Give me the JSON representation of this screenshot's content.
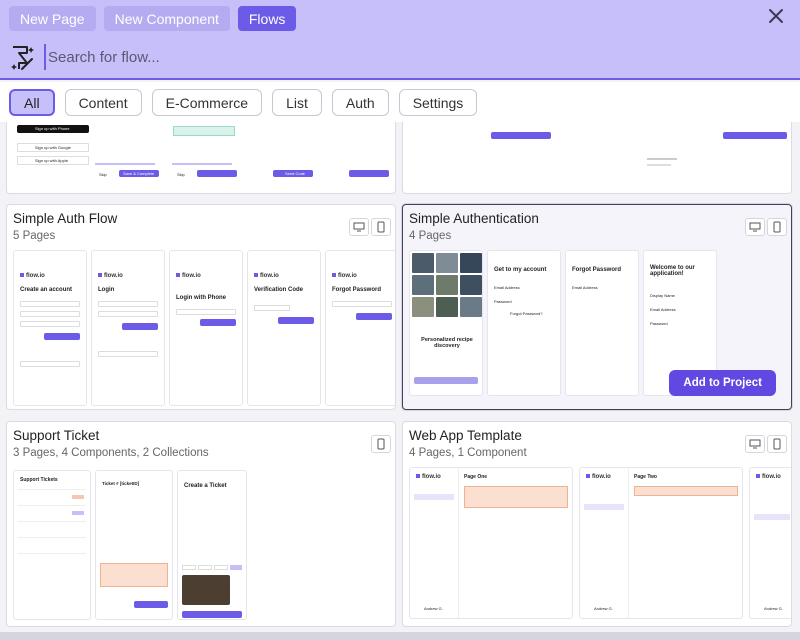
{
  "header": {
    "tabs": [
      {
        "label": "New Page",
        "active": false
      },
      {
        "label": "New Component",
        "active": false
      },
      {
        "label": "Flows",
        "active": true
      }
    ]
  },
  "search": {
    "placeholder": "Search for flow..."
  },
  "filters": [
    {
      "label": "All",
      "active": true
    },
    {
      "label": "Content",
      "active": false
    },
    {
      "label": "E-Commerce",
      "active": false
    },
    {
      "label": "List",
      "active": false
    },
    {
      "label": "Auth",
      "active": false
    },
    {
      "label": "Settings",
      "active": false
    }
  ],
  "colors": {
    "accent": "#6b5be6",
    "header_bg": "#c7bff9",
    "button": "#6048e0"
  },
  "cards": {
    "auth_flow": {
      "title": "Simple Auth Flow",
      "subtitle": "5 Pages"
    },
    "authentication": {
      "title": "Simple Authentication",
      "subtitle": "4 Pages",
      "action": "Add to Project"
    },
    "support": {
      "title": "Support Ticket",
      "subtitle": "3 Pages, 4 Components, 2 Collections"
    },
    "webapp": {
      "title": "Web App Template",
      "subtitle": "4 Pages, 1 Component"
    }
  },
  "previews": {
    "top_left": {
      "signup_btn": "Sign up with Phone",
      "google": "Sign up with Google",
      "apple": "Sign up with Apple",
      "skip": "Skip",
      "save": "Save & Complete",
      "send": "Send Code"
    },
    "auth_flow": {
      "logo": "flow.io",
      "screens": [
        "Create an account",
        "Login",
        "Login with Phone",
        "Verification Code",
        "Forgot Password"
      ],
      "button_labels": [
        "Create Account",
        "Login",
        "Continue",
        "Verify Code",
        "Send Reset Link"
      ]
    },
    "authentication": {
      "screens": [
        "Get to my account",
        "Forgot Password",
        "Welcome to our application!"
      ],
      "recipe": "Personalized recipe discovery",
      "fields": [
        "Email Address",
        "Password",
        "Forgot Password?",
        "Display Name"
      ]
    },
    "support": {
      "list_title": "Support Tickets",
      "ticket": "Ticket # [ticketID]",
      "create": "Create a Ticket",
      "submit": "Submit Ticket",
      "priority": [
        "Emergency",
        "Problem",
        "Feature",
        "Info"
      ]
    },
    "webapp": {
      "logo": "flow.io",
      "page1": "Page One",
      "page2": "Page Two",
      "user": "Andrew G."
    }
  }
}
